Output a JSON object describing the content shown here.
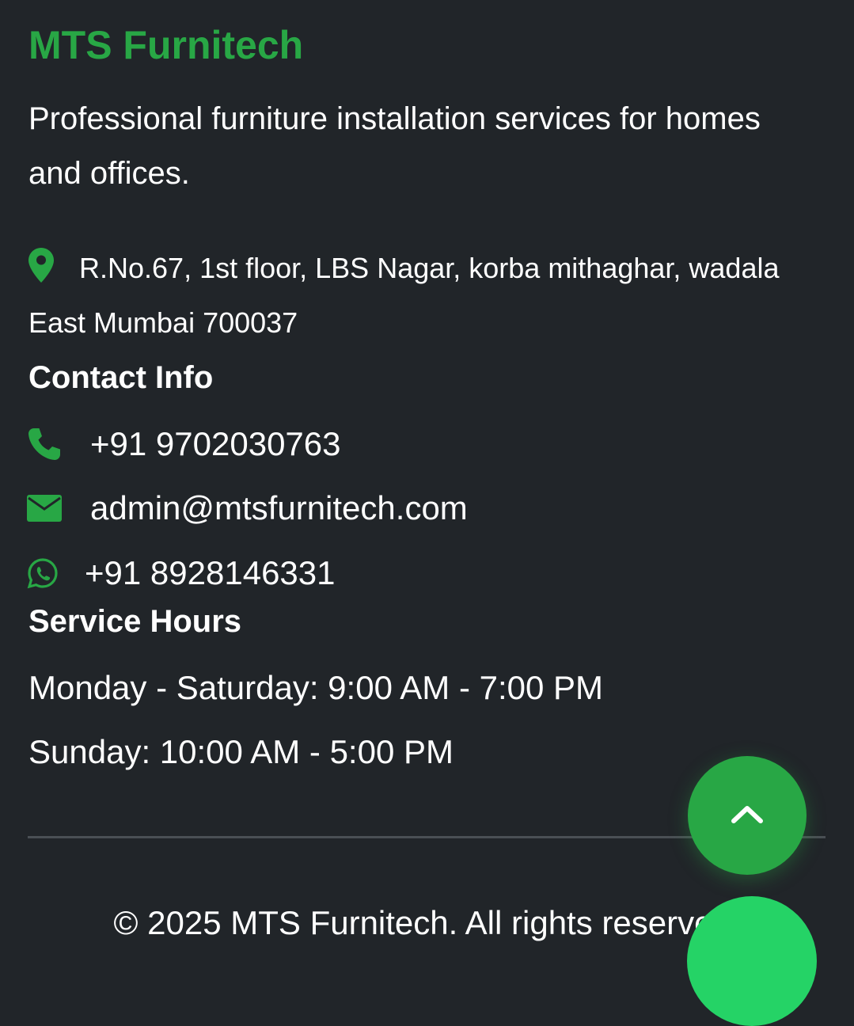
{
  "brand": {
    "name": "MTS Furnitech",
    "color": "#28a745"
  },
  "about": {
    "tagline": "Professional furniture installation services for homes and offices."
  },
  "address": {
    "icon": "map-marker-icon",
    "text": "R.No.67, 1st floor, LBS Nagar, korba mithaghar, wadala East Mumbai 700037"
  },
  "contact": {
    "heading": "Contact Info",
    "phone": {
      "icon": "phone-icon",
      "value": "+91 9702030763"
    },
    "email": {
      "icon": "envelope-icon",
      "value": "admin@mtsfurnitech.com"
    },
    "whatsapp": {
      "icon": "whatsapp-icon",
      "value": "+91 8928146331"
    }
  },
  "service_hours": {
    "heading": "Service Hours",
    "weekdays": "Monday - Saturday: 9:00 AM - 7:00 PM",
    "sunday": "Sunday: 10:00 AM - 5:00 PM"
  },
  "copyright": "© 2025 MTS Furnitech. All rights reserved.",
  "floating_buttons": {
    "back_to_top": {
      "icon": "chevron-up-icon",
      "color": "#28a745"
    },
    "whatsapp": {
      "color": "#25d366"
    }
  },
  "colors": {
    "background": "#212529",
    "accent": "#28a745",
    "text": "#ffffff",
    "divider": "#4a4f54"
  }
}
